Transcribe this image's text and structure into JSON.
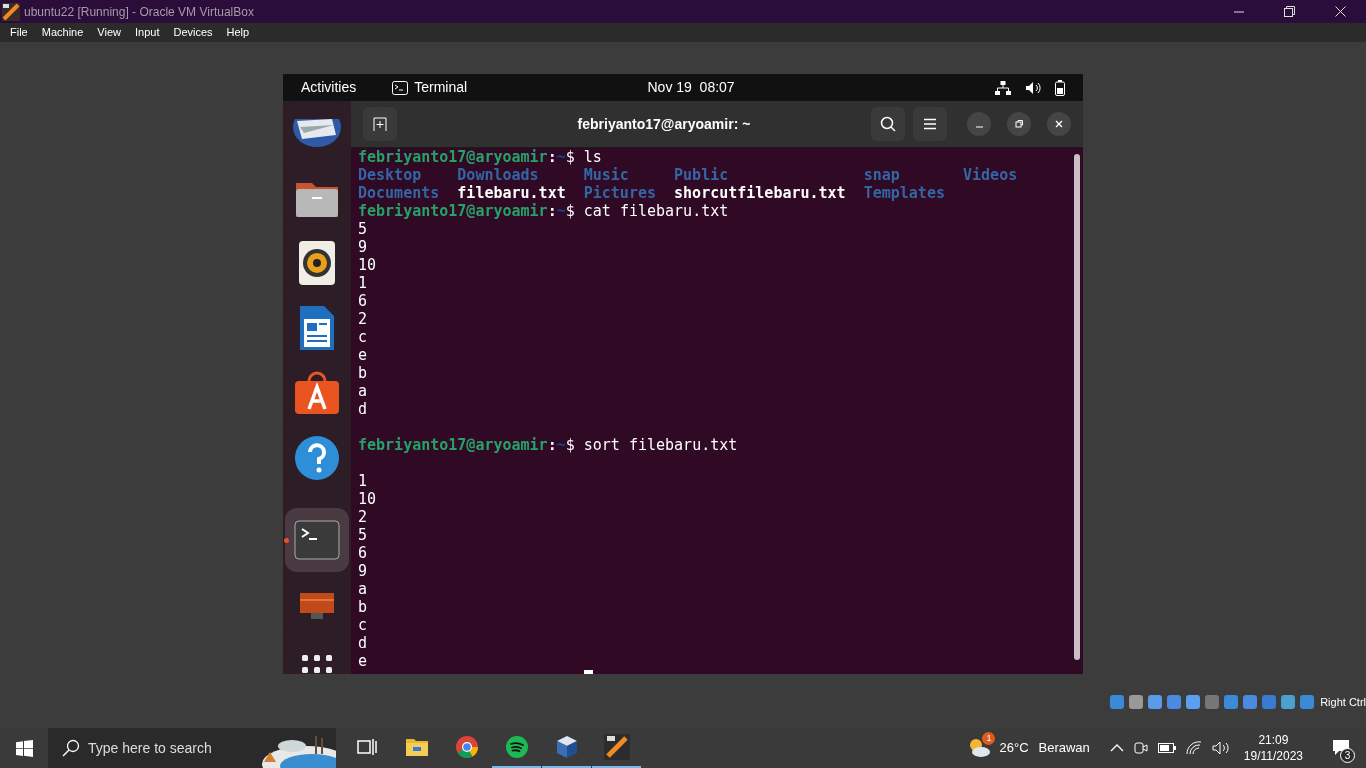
{
  "window": {
    "title": "ubuntu22 [Running] - Oracle VM VirtualBox"
  },
  "menu": [
    "File",
    "Machine",
    "View",
    "Input",
    "Devices",
    "Help"
  ],
  "gnome_bar": {
    "activities": "Activities",
    "app": "Terminal",
    "clock": "Nov 19  08:07"
  },
  "dock": [
    {
      "kind": "mail",
      "active": false
    },
    {
      "kind": "files",
      "active": false
    },
    {
      "kind": "music",
      "active": false
    },
    {
      "kind": "writer",
      "active": false
    },
    {
      "kind": "store",
      "active": false
    },
    {
      "kind": "help",
      "active": false
    },
    {
      "kind": "separator"
    },
    {
      "kind": "terminal",
      "active": true
    },
    {
      "kind": "screen",
      "active": false
    },
    {
      "kind": "grid",
      "active": false
    }
  ],
  "terminal": {
    "title": "febriyanto17@aryoamir: ~",
    "lines": [
      {
        "kind": "prompt",
        "user": "febriyanto17@aryoamir",
        "sep": ":",
        "path": "~",
        "sign": "$",
        "command": " ls"
      },
      {
        "kind": "ls",
        "entries": [
          {
            "text": "Desktop",
            "color": "#3465a4"
          },
          {
            "text": "Downloads",
            "color": "#3465a4"
          },
          {
            "text": "Music",
            "color": "#3465a4"
          },
          {
            "text": "Public",
            "color": "#3465a4"
          },
          {
            "text": "snap",
            "color": "#3465a4"
          },
          {
            "text": "Videos",
            "color": "#3465a4"
          }
        ]
      },
      {
        "kind": "ls",
        "entries": [
          {
            "text": "Documents",
            "color": "#3465a4"
          },
          {
            "text": "filebaru.txt",
            "color": "#ffffff"
          },
          {
            "text": "Pictures",
            "color": "#3465a4"
          },
          {
            "text": "shorcutfilebaru.txt",
            "color": "#ffffff"
          },
          {
            "text": "Templates",
            "color": "#3465a4"
          }
        ]
      },
      {
        "kind": "prompt",
        "user": "febriyanto17@aryoamir",
        "sep": ":",
        "path": "~",
        "sign": "$",
        "command": " cat filebaru.txt"
      },
      {
        "kind": "output",
        "text": "5"
      },
      {
        "kind": "output",
        "text": "9"
      },
      {
        "kind": "output",
        "text": "10"
      },
      {
        "kind": "output",
        "text": "1"
      },
      {
        "kind": "output",
        "text": "6"
      },
      {
        "kind": "output",
        "text": "2"
      },
      {
        "kind": "output",
        "text": "c"
      },
      {
        "kind": "output",
        "text": "e"
      },
      {
        "kind": "output",
        "text": "b"
      },
      {
        "kind": "output",
        "text": "a"
      },
      {
        "kind": "output",
        "text": "d"
      },
      {
        "kind": "blank"
      },
      {
        "kind": "prompt",
        "user": "febriyanto17@aryoamir",
        "sep": ":",
        "path": "~",
        "sign": "$",
        "command": " sort filebaru.txt"
      },
      {
        "kind": "blank"
      },
      {
        "kind": "output",
        "text": "1"
      },
      {
        "kind": "output",
        "text": "10"
      },
      {
        "kind": "output",
        "text": "2"
      },
      {
        "kind": "output",
        "text": "5"
      },
      {
        "kind": "output",
        "text": "6"
      },
      {
        "kind": "output",
        "text": "9"
      },
      {
        "kind": "output",
        "text": "a"
      },
      {
        "kind": "output",
        "text": "b"
      },
      {
        "kind": "output",
        "text": "c"
      },
      {
        "kind": "output",
        "text": "d"
      },
      {
        "kind": "output",
        "text": "e"
      },
      {
        "kind": "cursor"
      }
    ]
  },
  "vbox_status": {
    "host_key": "Right Ctrl"
  },
  "taskbar": {
    "search": {
      "placeholder": "Type here to search"
    },
    "apps": [
      {
        "kind": "taskview",
        "running": false
      },
      {
        "kind": "folder",
        "running": false
      },
      {
        "kind": "chrome",
        "running": false
      },
      {
        "kind": "spotify",
        "running": true
      },
      {
        "kind": "vbox",
        "running": true
      },
      {
        "kind": "vm",
        "running": true
      }
    ],
    "weather": {
      "badge": "1",
      "temp": "26°C",
      "condition": "Berawan"
    },
    "time": "21:09",
    "date": "19/11/2023",
    "notifications": "3"
  }
}
